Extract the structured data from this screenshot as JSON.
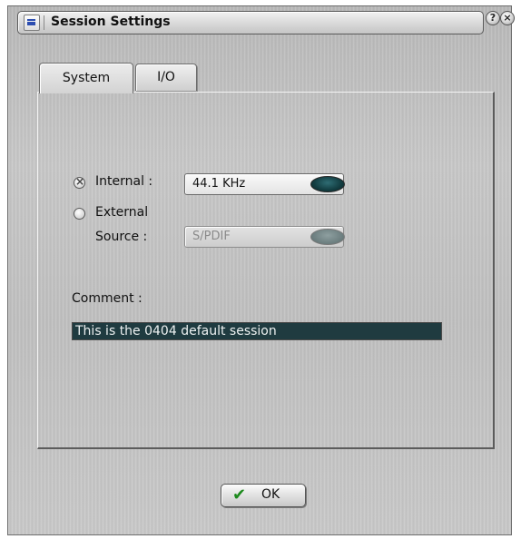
{
  "window": {
    "title": "Session Settings",
    "help_symbol": "?",
    "close_symbol": "×",
    "menu_icon": "menu-icon"
  },
  "tabs": [
    {
      "label": "System",
      "active": true
    },
    {
      "label": "I/O",
      "active": false
    }
  ],
  "clock": {
    "internal": {
      "label": "Internal :",
      "selected": true,
      "value": "44.1 KHz"
    },
    "external": {
      "label_line1": "External",
      "label_line2": "Source :",
      "selected": false,
      "value": "S/PDIF",
      "disabled": true
    }
  },
  "comment": {
    "label": "Comment :",
    "value": "This is the 0404 default session"
  },
  "ok_button": {
    "label": "OK",
    "icon": "checkmark-icon"
  },
  "colors": {
    "comment_bg": "#1f3b40",
    "knob_active": "#123c40",
    "check_green": "#1d8a1d"
  }
}
